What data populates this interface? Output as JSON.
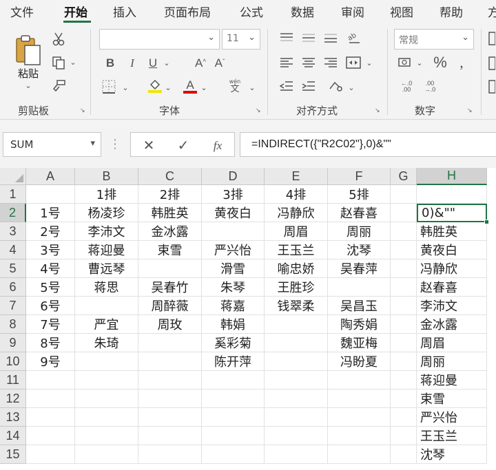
{
  "ribbon_tabs": [
    "文件",
    "开始",
    "插入",
    "页面布局",
    "公式",
    "数据",
    "审阅",
    "视图",
    "帮助",
    "方"
  ],
  "clipboard": {
    "paste_label": "粘贴",
    "group_label": "剪贴板"
  },
  "font": {
    "size_value": "11",
    "group_label": "字体",
    "grow_label": "A",
    "shrink_label": "A",
    "phonetic_label": "wén"
  },
  "alignment": {
    "group_label": "对齐方式"
  },
  "number": {
    "format_value": "常规",
    "group_label": "数字"
  },
  "name_box": {
    "value": "SUM"
  },
  "formula_bar": {
    "value": "=INDIRECT({\"R2C02\"},0)&\"\""
  },
  "columns": [
    "A",
    "B",
    "C",
    "D",
    "E",
    "F",
    "G",
    "H"
  ],
  "rows": [
    "1",
    "2",
    "3",
    "4",
    "5",
    "6",
    "7",
    "8",
    "9",
    "10",
    "11",
    "12",
    "13",
    "14",
    "15"
  ],
  "cells": [
    [
      "",
      "1排",
      "2排",
      "3排",
      "4排",
      "5排",
      "",
      ""
    ],
    [
      "1号",
      "杨凌珍",
      "韩胜英",
      "黄夜白",
      "冯静欣",
      "赵春喜",
      "",
      "0)&\"\""
    ],
    [
      "2号",
      "李沛文",
      "金冰露",
      "",
      "周眉",
      "周丽",
      "",
      "韩胜英"
    ],
    [
      "3号",
      "蒋迎曼",
      "束雪",
      "严兴怡",
      "王玉兰",
      "沈琴",
      "",
      "黄夜白"
    ],
    [
      "4号",
      "曹远琴",
      "",
      "滑雪",
      "喻忠娇",
      "吴春萍",
      "",
      "冯静欣"
    ],
    [
      "5号",
      "蒋思",
      "吴春竹",
      "朱琴",
      "王胜珍",
      "",
      "",
      "赵春喜"
    ],
    [
      "6号",
      "",
      "周醉薇",
      "蒋嘉",
      "钱翠柔",
      "吴昌玉",
      "",
      "李沛文"
    ],
    [
      "7号",
      "严宜",
      "周玫",
      "韩娟",
      "",
      "陶秀娟",
      "",
      "金冰露"
    ],
    [
      "8号",
      "朱琦",
      "",
      "奚彩菊",
      "",
      "魏亚梅",
      "",
      "周眉"
    ],
    [
      "9号",
      "",
      "",
      "陈开萍",
      "",
      "冯盼夏",
      "",
      "周丽"
    ],
    [
      "",
      "",
      "",
      "",
      "",
      "",
      "",
      "蒋迎曼"
    ],
    [
      "",
      "",
      "",
      "",
      "",
      "",
      "",
      "束雪"
    ],
    [
      "",
      "",
      "",
      "",
      "",
      "",
      "",
      "严兴怡"
    ],
    [
      "",
      "",
      "",
      "",
      "",
      "",
      "",
      "王玉兰"
    ],
    [
      "",
      "",
      "",
      "",
      "",
      "",
      "",
      "沈琴"
    ]
  ],
  "colors": {
    "accent": "#217346",
    "ribbon_bg": "#f3f3f3",
    "header_bg": "#e9e9e9"
  }
}
